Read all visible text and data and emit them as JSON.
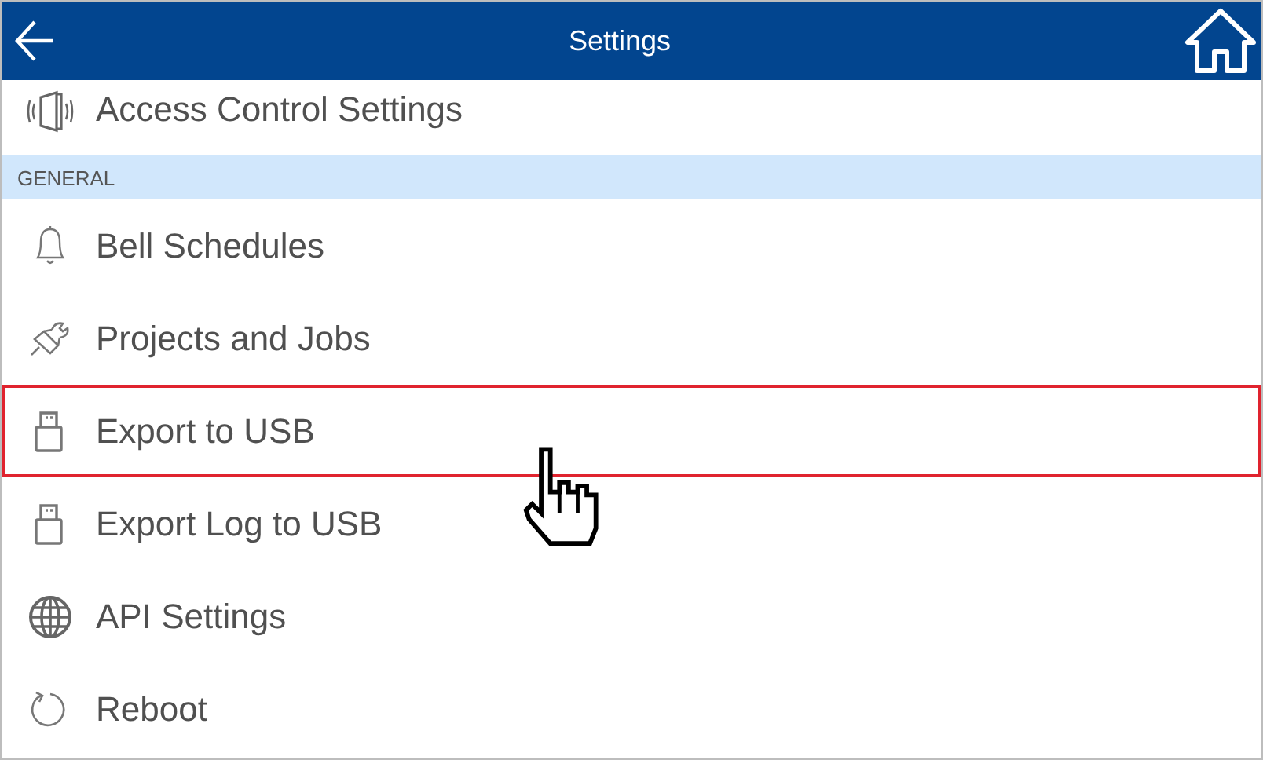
{
  "header": {
    "title": "Settings"
  },
  "top_items": [
    {
      "label": "Access Control Settings",
      "selected": false
    }
  ],
  "sections": [
    {
      "heading": "GENERAL",
      "items": [
        {
          "label": "Bell Schedules",
          "selected": false
        },
        {
          "label": "Projects and Jobs",
          "selected": false
        },
        {
          "label": "Export to USB",
          "selected": true
        },
        {
          "label": "Export Log to USB",
          "selected": false
        },
        {
          "label": "API Settings",
          "selected": false
        },
        {
          "label": "Reboot",
          "selected": false
        }
      ]
    }
  ]
}
